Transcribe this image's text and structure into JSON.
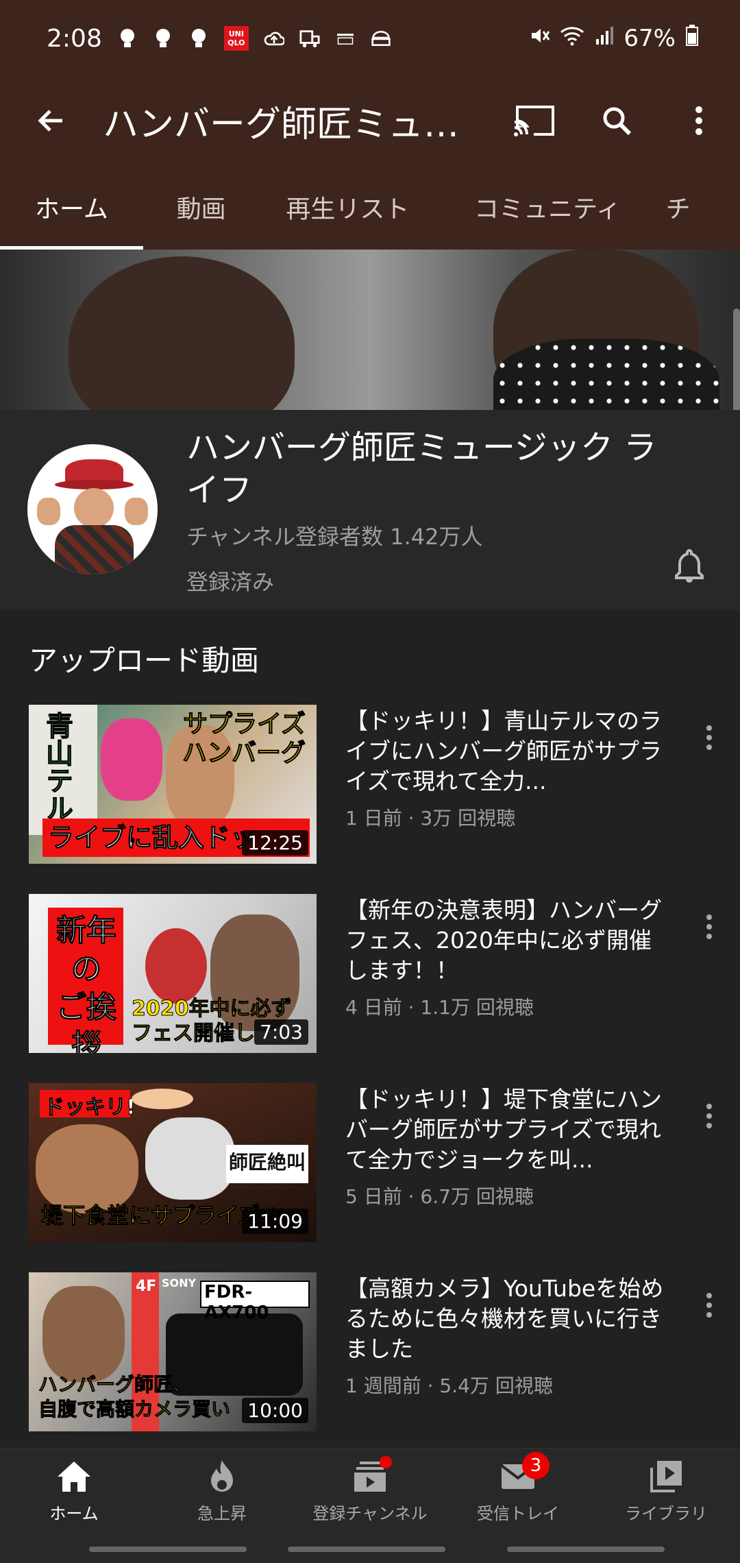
{
  "status_bar": {
    "time": "2:08",
    "uniqlo": "UNI QLO",
    "battery": "67%"
  },
  "app_bar": {
    "title": "ハンバーグ師匠ミュー..."
  },
  "tabs": [
    {
      "label": "ホーム"
    },
    {
      "label": "動画"
    },
    {
      "label": "再生リスト"
    },
    {
      "label": "コミュニティ"
    },
    {
      "label": "チ"
    }
  ],
  "channel": {
    "name": "ハンバーグ師匠ミュージック ライフ",
    "subscribers": "チャンネル登録者数 1.42万人",
    "status": "登録済み"
  },
  "uploads": {
    "heading": "アップロード動画",
    "videos": [
      {
        "title": "【ドッキリ！】青山テルマのライブにハンバーグ師匠がサプライズで現れて全力...",
        "meta": "1 日前 · 3万 回視聴",
        "duration": "12:25",
        "thumb_text": {
          "a": "青山テルマ",
          "b": "サプライズ",
          "c": "ハンバーグ",
          "d": "ライブに乱入ドッ"
        }
      },
      {
        "title": "【新年の決意表明】ハンバーグフェス、2020年中に必ず開催します！！",
        "meta": "4 日前 · 1.1万 回視聴",
        "duration": "7:03",
        "thumb_text": {
          "a": "新年の",
          "b": "ご挨拶",
          "c": "2020年中に必ず",
          "d": "フェス開催し"
        }
      },
      {
        "title": "【ドッキリ！】堤下食堂にハンバーグ師匠がサプライズで現れて全力でジョークを叫...",
        "meta": "5 日前 · 6.7万 回視聴",
        "duration": "11:09",
        "thumb_text": {
          "a": "ドッキリ!",
          "b": "師匠絶叫",
          "c": "堤下食堂にサプライズハ"
        }
      },
      {
        "title": "【高額カメラ】YouTubeを始めるために色々機材を買いに行きました",
        "meta": "1 週間前 · 5.4万 回視聴",
        "duration": "10:00",
        "thumb_text": {
          "a": "FDR-AX700",
          "b": "ハンバーグ師匠、",
          "c": "自腹で高額カメラ買い",
          "d": "SONY",
          "e": "4F"
        }
      }
    ]
  },
  "bottom_nav": [
    {
      "label": "ホーム"
    },
    {
      "label": "急上昇"
    },
    {
      "label": "登録チャンネル"
    },
    {
      "label": "受信トレイ",
      "badge": "3"
    },
    {
      "label": "ライブラリ"
    }
  ]
}
